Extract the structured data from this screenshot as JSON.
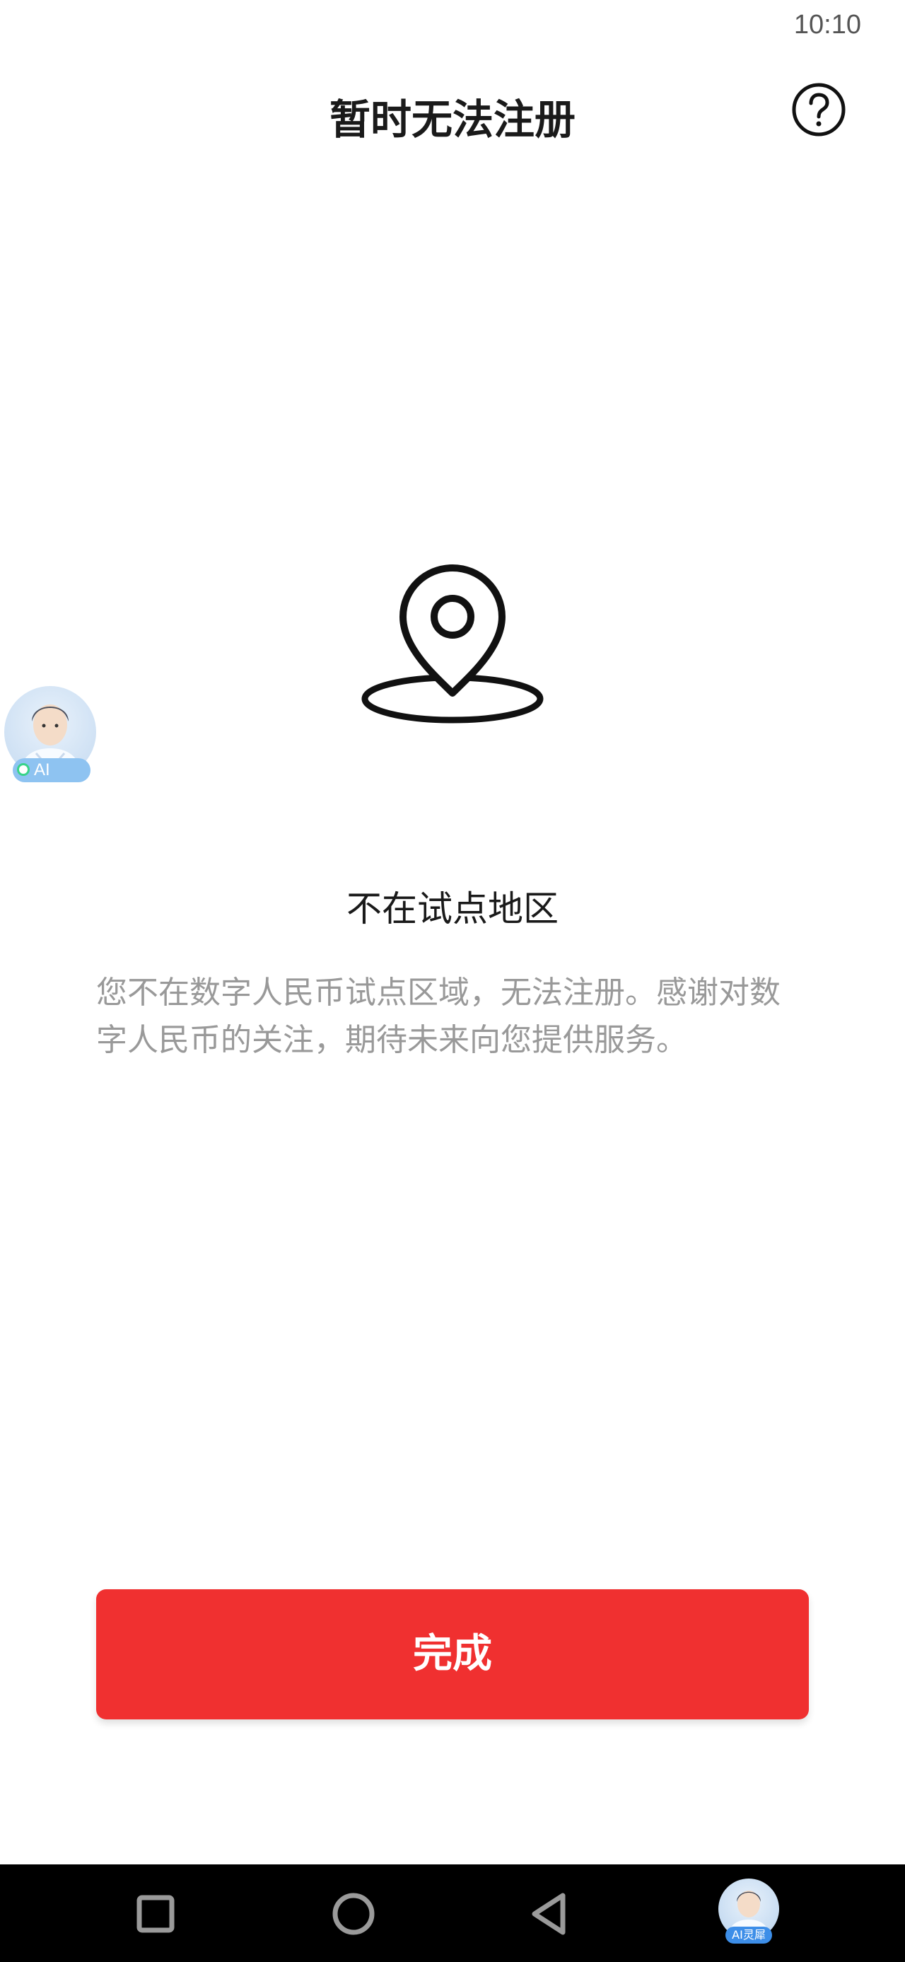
{
  "status_bar": {
    "time": "10:10"
  },
  "header": {
    "title": "暂时无法注册",
    "help_icon": "question-circle-icon"
  },
  "main": {
    "icon": "location-pin-icon",
    "heading": "不在试点地区",
    "description": "您不在数字人民币试点区域，无法注册。感谢对数字人民币的关注，期待未来向您提供服务。"
  },
  "ai_assistant": {
    "badge_label": "AI"
  },
  "actions": {
    "done_label": "完成",
    "done_color": "#f03030"
  },
  "nav_bar": {
    "recents_icon": "square-icon",
    "home_icon": "circle-icon",
    "back_icon": "triangle-back-icon",
    "assistant_label": "AI灵犀"
  }
}
